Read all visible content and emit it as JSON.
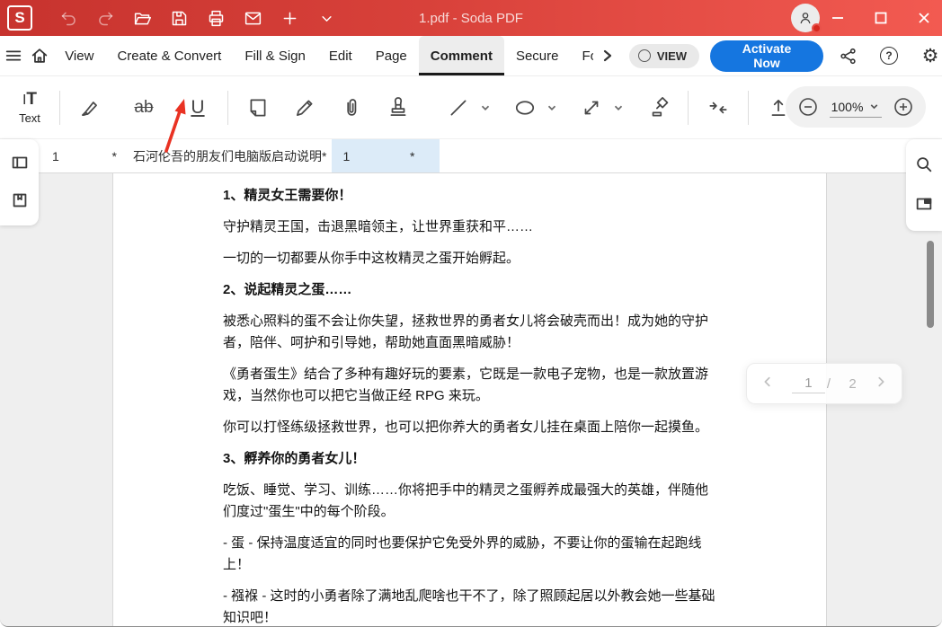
{
  "titlebar": {
    "logo": "S",
    "title": "1.pdf  -  Soda PDF"
  },
  "menu": {
    "items": [
      "View",
      "Create & Convert",
      "Fill & Sign",
      "Edit",
      "Page",
      "Comment",
      "Secure",
      "Fo"
    ],
    "view_toggle_label": "VIEW",
    "activate_label": "Activate Now",
    "help_glyph": "?",
    "gear_glyph": "⚙"
  },
  "toolbar": {
    "text_tool": {
      "glyph_i": "I",
      "glyph_t": "T",
      "label": "Text"
    },
    "strike_glyph": "ab",
    "underline_glyph": "U",
    "zoom_value": "100%"
  },
  "tabs": [
    {
      "label": "1",
      "modified": "*"
    },
    {
      "label": "石河伦吾的朋友们电脑版启动说明*",
      "modified": ""
    },
    {
      "label": "1",
      "modified": "*"
    }
  ],
  "document": {
    "blocks": [
      {
        "type": "heading",
        "text": "1、精灵女王需要你！"
      },
      {
        "type": "para",
        "text": "守护精灵王国，击退黑暗领主，让世界重获和平……"
      },
      {
        "type": "para",
        "text": "一切的一切都要从你手中这枚精灵之蛋开始孵起。"
      },
      {
        "type": "heading",
        "text": "2、说起精灵之蛋……"
      },
      {
        "type": "para",
        "text": "被悉心照料的蛋不会让你失望，拯救世界的勇者女儿将会破壳而出！成为她的守护者，陪伴、呵护和引导她，帮助她直面黑暗威胁！"
      },
      {
        "type": "para",
        "text": "《勇者蛋生》结合了多种有趣好玩的要素，它既是一款电子宠物，也是一款放置游戏，当然你也可以把它当做正经 RPG 来玩。"
      },
      {
        "type": "para",
        "text": "你可以打怪练级拯救世界，也可以把你养大的勇者女儿挂在桌面上陪你一起摸鱼。"
      },
      {
        "type": "heading",
        "text": "3、孵养你的勇者女儿！"
      },
      {
        "type": "para",
        "text": "吃饭、睡觉、学习、训练……你将把手中的精灵之蛋孵养成最强大的英雄，伴随他们度过\"蛋生\"中的每个阶段。"
      },
      {
        "type": "para",
        "text": "- 蛋 - 保持温度适宜的同时也要保护它免受外界的威胁，不要让你的蛋输在起跑线上！"
      },
      {
        "type": "para",
        "text": "- 襁褓 - 这时的小勇者除了满地乱爬啥也干不了，除了照顾起居以外教会她一些基础知识吧！"
      }
    ]
  },
  "pagenav": {
    "current": "1",
    "separator": "/",
    "total": "2"
  },
  "colors": {
    "accent_red": "#d8413a",
    "accent_blue": "#1576e0",
    "active_tab": "#dcebf8",
    "annotation": "#e93223"
  }
}
